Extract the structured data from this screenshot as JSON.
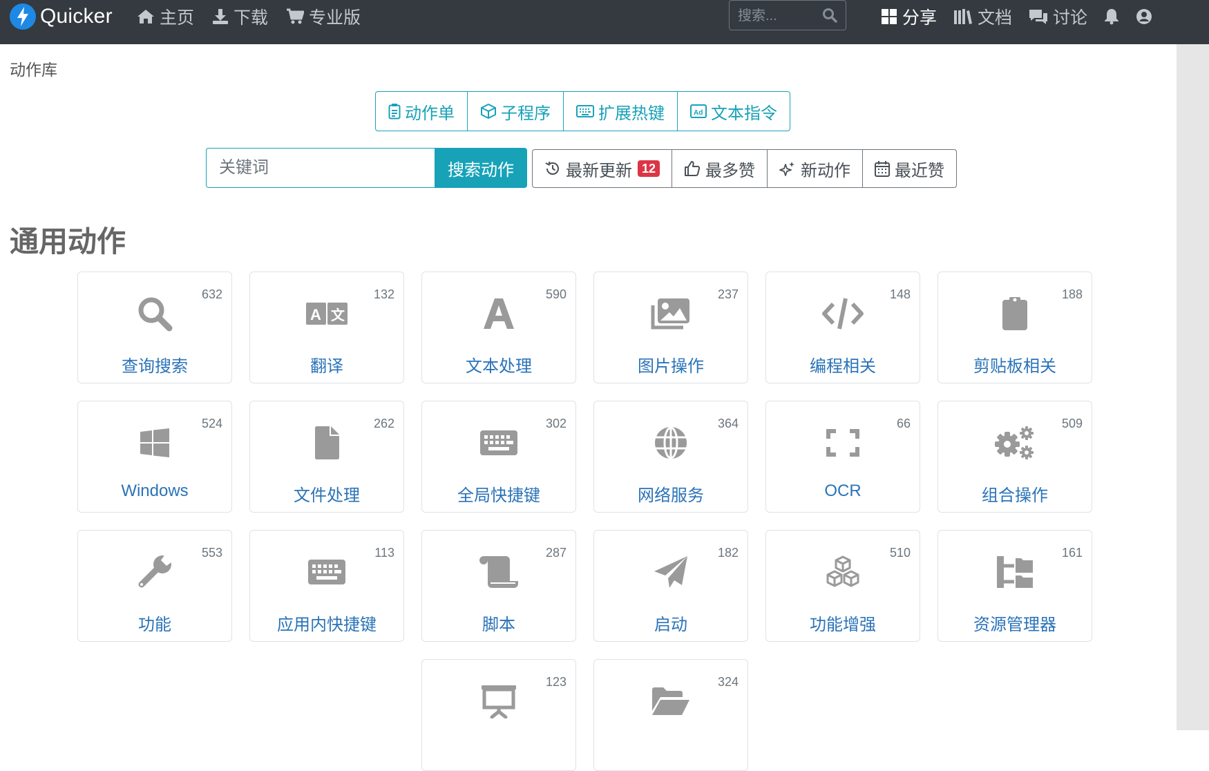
{
  "navbar": {
    "brand": "Quicker",
    "links": [
      {
        "label": "主页",
        "icon": "home-icon"
      },
      {
        "label": "下载",
        "icon": "download-icon"
      },
      {
        "label": "专业版",
        "icon": "cart-icon"
      }
    ],
    "search_placeholder": "搜索...",
    "right_links": [
      {
        "label": "分享",
        "icon": "grid-icon"
      },
      {
        "label": "文档",
        "icon": "book-icon"
      },
      {
        "label": "讨论",
        "icon": "comments-icon"
      }
    ],
    "right_icons": [
      "bell-icon",
      "user-icon"
    ]
  },
  "breadcrumb": "动作库",
  "type_tabs": [
    {
      "label": "动作单",
      "icon": "clipboard-list-icon"
    },
    {
      "label": "子程序",
      "icon": "cube-icon"
    },
    {
      "label": "扩展热键",
      "icon": "keyboard-icon"
    },
    {
      "label": "文本指令",
      "icon": "ad-icon"
    }
  ],
  "search": {
    "placeholder": "关键词",
    "button": "搜索动作"
  },
  "sort_tabs": [
    {
      "label": "最新更新",
      "icon": "history-icon",
      "badge": "12"
    },
    {
      "label": "最多赞",
      "icon": "thumbs-up-icon"
    },
    {
      "label": "新动作",
      "icon": "stars-icon"
    },
    {
      "label": "最近赞",
      "icon": "calendar-icon"
    }
  ],
  "section_title": "通用动作",
  "categories": [
    {
      "name": "查询搜索",
      "count": "632",
      "icon": "search-icon"
    },
    {
      "name": "翻译",
      "count": "132",
      "icon": "language-icon"
    },
    {
      "name": "文本处理",
      "count": "590",
      "icon": "font-icon"
    },
    {
      "name": "图片操作",
      "count": "237",
      "icon": "images-icon"
    },
    {
      "name": "编程相关",
      "count": "148",
      "icon": "code-icon"
    },
    {
      "name": "剪贴板相关",
      "count": "188",
      "icon": "clipboard-icon"
    },
    {
      "name": "Windows",
      "count": "524",
      "icon": "windows-icon"
    },
    {
      "name": "文件处理",
      "count": "262",
      "icon": "file-icon"
    },
    {
      "name": "全局快捷键",
      "count": "302",
      "icon": "keyboard-icon"
    },
    {
      "name": "网络服务",
      "count": "364",
      "icon": "globe-icon"
    },
    {
      "name": "OCR",
      "count": "66",
      "icon": "expand-icon"
    },
    {
      "name": "组合操作",
      "count": "509",
      "icon": "cogs-icon"
    },
    {
      "name": "功能",
      "count": "553",
      "icon": "wrench-icon"
    },
    {
      "name": "应用内快捷键",
      "count": "113",
      "icon": "keyboard-icon"
    },
    {
      "name": "脚本",
      "count": "287",
      "icon": "scroll-icon"
    },
    {
      "name": "启动",
      "count": "182",
      "icon": "paper-plane-icon"
    },
    {
      "name": "功能增强",
      "count": "510",
      "icon": "cubes-icon"
    },
    {
      "name": "资源管理器",
      "count": "161",
      "icon": "sitemap-icon"
    },
    {
      "name": "",
      "count": "123",
      "icon": "presentation-icon"
    },
    {
      "name": "",
      "count": "324",
      "icon": "folder-open-icon"
    }
  ],
  "colors": {
    "navbar": "#343a40",
    "accent": "#17a2b8",
    "link": "#2a73b8",
    "badge": "#dc3545",
    "icon": "#9a9a9a"
  }
}
